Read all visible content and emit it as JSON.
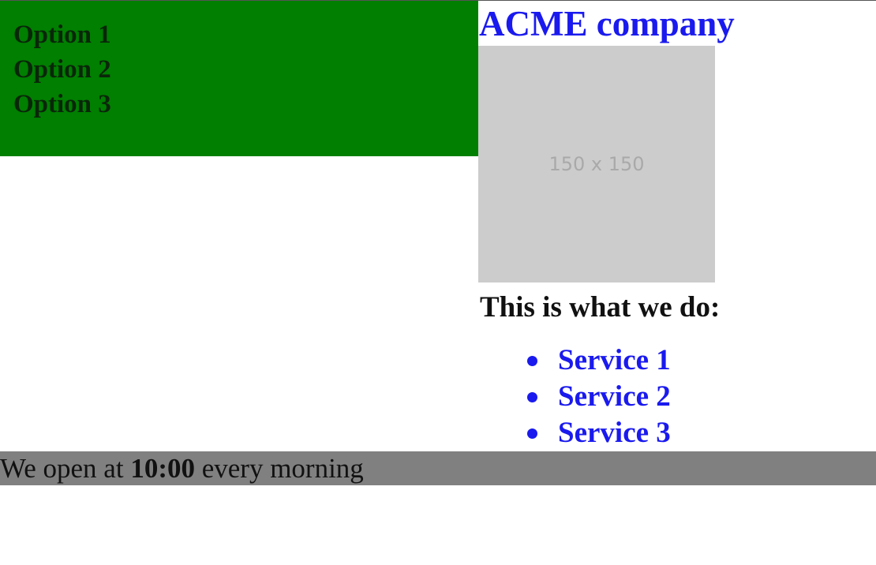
{
  "sidebar": {
    "items": [
      {
        "label": "Option 1"
      },
      {
        "label": "Option 2"
      },
      {
        "label": "Option 3"
      }
    ]
  },
  "header": {
    "title": "ACME company"
  },
  "image": {
    "placeholder_text": "150 x 150"
  },
  "main": {
    "heading": "This is what we do:",
    "services": [
      {
        "label": "Service 1"
      },
      {
        "label": "Service 2"
      },
      {
        "label": "Service 3"
      }
    ]
  },
  "footer": {
    "text_before": "We open at ",
    "time": "10:00",
    "text_after": " every morning"
  },
  "colors": {
    "sidebar_background": "#007f00",
    "link_blue": "#1a1aee",
    "footer_background": "#808080",
    "image_placeholder": "#cccccc"
  }
}
